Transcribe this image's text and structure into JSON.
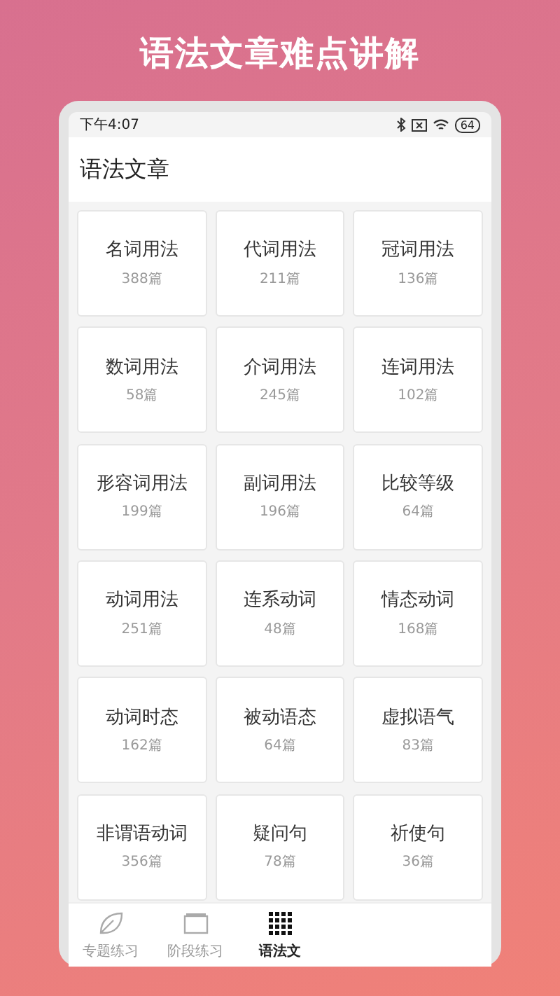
{
  "banner": {
    "title": "语法文章难点讲解"
  },
  "status_bar": {
    "time": "下午4:07",
    "battery": "64"
  },
  "header": {
    "title": "语法文章"
  },
  "categories": [
    {
      "name": "名词用法",
      "count": "388篇"
    },
    {
      "name": "代词用法",
      "count": "211篇"
    },
    {
      "name": "冠词用法",
      "count": "136篇"
    },
    {
      "name": "数词用法",
      "count": "58篇"
    },
    {
      "name": "介词用法",
      "count": "245篇"
    },
    {
      "name": "连词用法",
      "count": "102篇"
    },
    {
      "name": "形容词用法",
      "count": "199篇"
    },
    {
      "name": "副词用法",
      "count": "196篇"
    },
    {
      "name": "比较等级",
      "count": "64篇"
    },
    {
      "name": "动词用法",
      "count": "251篇"
    },
    {
      "name": "连系动词",
      "count": "48篇"
    },
    {
      "name": "情态动词",
      "count": "168篇"
    },
    {
      "name": "动词时态",
      "count": "162篇"
    },
    {
      "name": "被动语态",
      "count": "64篇"
    },
    {
      "name": "虚拟语气",
      "count": "83篇"
    },
    {
      "name": "非谓语动词",
      "count": "356篇"
    },
    {
      "name": "疑问句",
      "count": "78篇"
    },
    {
      "name": "祈使句",
      "count": "36篇"
    }
  ],
  "tabs": [
    {
      "label": "专题练习",
      "kind": "leaf",
      "selected": false
    },
    {
      "label": "阶段练习",
      "kind": "folder",
      "selected": false
    },
    {
      "label": "语法文",
      "kind": "grid",
      "selected": true
    }
  ]
}
